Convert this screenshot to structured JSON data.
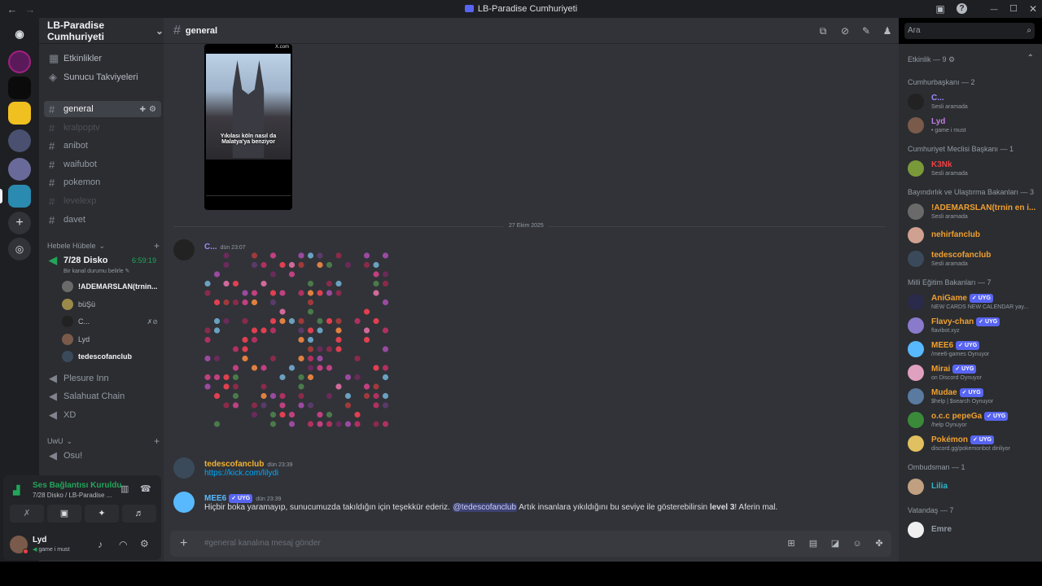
{
  "window": {
    "title": "LB-Paradise Cumhuriyeti",
    "back": "←",
    "forward": "→",
    "minimize": "—",
    "maximize": "☐",
    "close": "✕"
  },
  "server": {
    "name": "LB-Paradise Cumhuriyeti"
  },
  "sidebar": {
    "items": [
      {
        "label": "Etkinlikler"
      },
      {
        "label": "Sunucu Takviyeleri"
      }
    ],
    "channels": [
      {
        "name": "general",
        "state": "active"
      },
      {
        "name": "kralpoptv",
        "state": "muted"
      },
      {
        "name": "anibot",
        "state": "normal"
      },
      {
        "name": "waifubot",
        "state": "normal"
      },
      {
        "name": "pokemon",
        "state": "normal"
      },
      {
        "name": "levelexp",
        "state": "muted"
      },
      {
        "name": "davet",
        "state": "normal"
      }
    ],
    "category1": "Hebele Hübele",
    "voice": {
      "name": "7/28 Disko",
      "timer": "6:59:19",
      "status": "Bir kanal durumu belirle",
      "users": [
        {
          "name": "!ADEMARSLAN(trnin..."
        },
        {
          "name": "büŞü"
        },
        {
          "name": "C..."
        },
        {
          "name": "Lyd"
        },
        {
          "name": "tedescofanclub"
        }
      ]
    },
    "voice_channels": [
      {
        "name": "Plesure Inn"
      },
      {
        "name": "Salahuat Chain"
      },
      {
        "name": "XD"
      }
    ],
    "category2": "UwU",
    "category2_channel": "Osu!"
  },
  "voice_panel": {
    "status": "Ses Bağlantısı Kuruldu",
    "channel": "7/28 Disko / LB-Paradise ..."
  },
  "user": {
    "name": "Lyd",
    "status": "game i must"
  },
  "chat": {
    "channel": "general",
    "image_caption": "Yıkılası köln nasıl da Malatya'ya benziyor",
    "image_header": "X.com",
    "date_divider": "27 Ekim 2025",
    "messages": [
      {
        "author": "C...",
        "time": "dün 23:07",
        "color": "#9a8cff"
      },
      {
        "author": "tedescofanclub",
        "time": "dün 23:39",
        "color": "#f0b232",
        "link": "https://kick.com/lilydi"
      },
      {
        "author": "MEE6",
        "badge": "UYG",
        "time": "dün 23:39",
        "color": "#58b9ff",
        "text_pre": "Hiçbir boka yaramayıp, sunucumuzda takıldığın için teşekkür ederiz.",
        "mention": "@tedescofanclub",
        "text_mid": "Artık insanlara yıkıldığını bu seviye ile gösterebilirsin",
        "bold": "level 3",
        "text_post": "! Aferin mal."
      }
    ],
    "placeholder": "#general kanalına mesaj gönder"
  },
  "search": {
    "placeholder": "Ara"
  },
  "members": {
    "activity_label": "Etkinlik — 9",
    "groups": [
      {
        "title": "Cumhurbaşkanı — 2",
        "members": [
          {
            "name": "C...",
            "status": "Sesli aramada",
            "color": "#9a8cff"
          },
          {
            "name": "Lyd",
            "status": "• game i must",
            "color": "#c07be0"
          }
        ]
      },
      {
        "title": "Cumhuriyet Meclisi Başkanı — 1",
        "members": [
          {
            "name": "K3Nk",
            "status": "Sesli aramada",
            "color": "#ed4245"
          }
        ]
      },
      {
        "title": "Bayındırlık ve Ulaştırma Bakanları — 3",
        "members": [
          {
            "name": "!ADEMARSLAN(trnin en i...",
            "status": "Sesli aramada",
            "color": "#f0a030"
          },
          {
            "name": "nehirfanclub",
            "status": "",
            "color": "#f0a030"
          },
          {
            "name": "tedescofanclub",
            "status": "Sesli aramada",
            "color": "#f0a030"
          }
        ]
      },
      {
        "title": "Milli Eğitim Bakanları — 7",
        "members": [
          {
            "name": "AniGame",
            "badge": "UYG",
            "status": "NEW CARDS NEW CALENDAR yay...",
            "color": "#f0a030"
          },
          {
            "name": "Flavy-chan",
            "badge": "UYG",
            "status": "flavibot.xyz",
            "color": "#f0a030"
          },
          {
            "name": "MEE6",
            "badge": "UYG",
            "status": "/mee6-games Oynuyor",
            "color": "#f0a030"
          },
          {
            "name": "Mirai",
            "badge": "UYG",
            "status": "on Discord Oynuyor",
            "color": "#f0a030"
          },
          {
            "name": "Mudae",
            "badge": "UYG",
            "status": "$help | $search Oynuyor",
            "color": "#f0a030"
          },
          {
            "name": "o.c.c pepeGa",
            "badge": "UYG",
            "status": "/help Oynuyor",
            "color": "#f0a030"
          },
          {
            "name": "Pokémon",
            "badge": "UYG",
            "status": "discord.gg/pokemonbot dinliyor",
            "color": "#f0a030"
          }
        ]
      },
      {
        "title": "Ombudsman — 1",
        "members": [
          {
            "name": "Lilia",
            "status": "",
            "color": "#2fb6c8"
          }
        ]
      },
      {
        "title": "Vatandaş — 7",
        "members": [
          {
            "name": "Emre",
            "status": "",
            "color": "#949ba4"
          }
        ]
      }
    ]
  },
  "colors": {
    "accent": "#5865f2",
    "online": "#23a55a",
    "dnd": "#f23f43",
    "link": "#00a8fc"
  }
}
